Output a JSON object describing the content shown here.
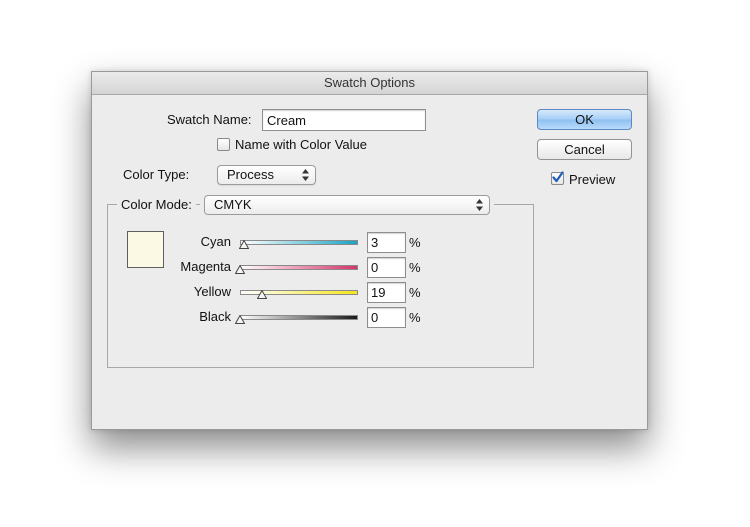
{
  "window": {
    "title": "Swatch Options"
  },
  "swatch_name": {
    "label": "Swatch Name:",
    "value": "Cream"
  },
  "name_with_color_value": {
    "label": "Name with Color Value",
    "checked": false
  },
  "color_type": {
    "label": "Color Type:",
    "value": "Process"
  },
  "color_mode": {
    "label": "Color Mode:",
    "value": "CMYK"
  },
  "swatch_color": "#fbf9e4",
  "sliders": [
    {
      "label": "Cyan",
      "value": "3",
      "unit": "%",
      "percent": 3,
      "color": "#1aa3c4"
    },
    {
      "label": "Magenta",
      "value": "0",
      "unit": "%",
      "percent": 0,
      "color": "#d6336c"
    },
    {
      "label": "Yellow",
      "value": "19",
      "unit": "%",
      "percent": 19,
      "color": "#f5e51c"
    },
    {
      "label": "Black",
      "value": "0",
      "unit": "%",
      "percent": 0,
      "color": "#1a1a1a"
    }
  ],
  "buttons": {
    "ok": "OK",
    "cancel": "Cancel"
  },
  "preview": {
    "label": "Preview",
    "checked": true
  },
  "colors": {
    "accent": "#8ec0f0",
    "check": "#1f5fb8"
  }
}
